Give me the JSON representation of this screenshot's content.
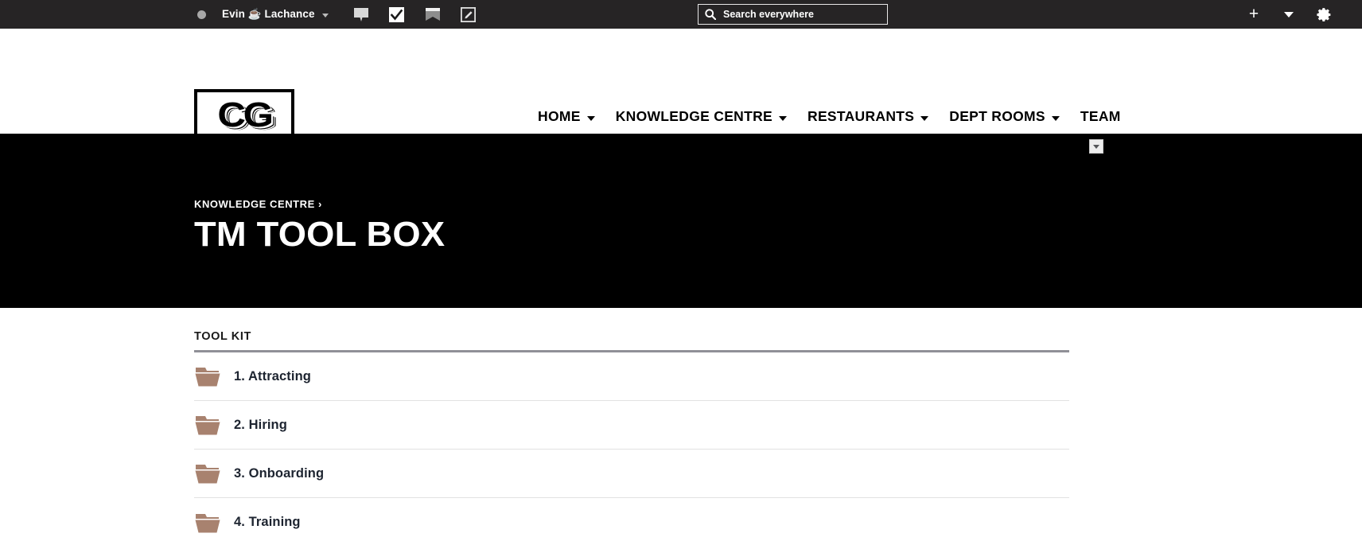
{
  "topbar": {
    "status_dot": "status-dot",
    "user_name": "Evin ☕ Lachance",
    "user_caret_icon": "chevron-down-icon",
    "icons": [
      {
        "name": "comment-icon",
        "label": "Comments"
      },
      {
        "name": "task-check-icon",
        "label": "Tasks"
      },
      {
        "name": "bookmark-icon",
        "label": "Bookmarks"
      },
      {
        "name": "note-edit-icon",
        "label": "Notes"
      }
    ],
    "search": {
      "placeholder": "Search everywhere",
      "value": "",
      "icon": "search-icon"
    },
    "actions": [
      {
        "name": "add-button",
        "icon": "plus-icon",
        "glyph": "+"
      },
      {
        "name": "more-menu-button",
        "icon": "chevron-down-icon"
      },
      {
        "name": "settings-button",
        "icon": "gear-icon"
      }
    ],
    "background_color": "#262425"
  },
  "header": {
    "logo": {
      "text": "CG",
      "name": "cg-logo"
    },
    "nav": [
      {
        "label": "HOME",
        "has_dropdown": true
      },
      {
        "label": "KNOWLEDGE CENTRE",
        "has_dropdown": true
      },
      {
        "label": "RESTAURANTS",
        "has_dropdown": true
      },
      {
        "label": "DEPT ROOMS",
        "has_dropdown": true
      },
      {
        "label": "TEAM",
        "has_dropdown": false
      }
    ]
  },
  "hero": {
    "breadcrumb": "KNOWLEDGE CENTRE ›",
    "title": "TM TOOL BOX",
    "background_color": "#000000",
    "toggle_icon": "chevron-down-icon"
  },
  "main": {
    "section_title": "TOOL KIT",
    "folder_color": "#a8826f",
    "items": [
      {
        "label": "1. Attracting",
        "icon": "folder-icon"
      },
      {
        "label": "2. Hiring",
        "icon": "folder-icon"
      },
      {
        "label": "3. Onboarding",
        "icon": "folder-icon"
      },
      {
        "label": "4. Training",
        "icon": "folder-icon"
      }
    ]
  },
  "colors": {
    "topbar_bg": "#262425",
    "hero_bg": "#000000",
    "folder": "#a8826f",
    "rule": "#909097",
    "text_dark": "#1d2430"
  }
}
